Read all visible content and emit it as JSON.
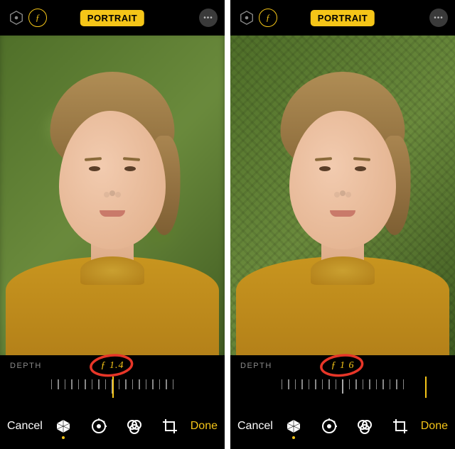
{
  "screens": [
    {
      "mode_label": "PORTRAIT",
      "depth_label": "DEPTH",
      "f_value": "ƒ 1.4",
      "background": "blurred",
      "cancel": "Cancel",
      "done": "Done",
      "needle_pos": "center",
      "annotation": "red-circle"
    },
    {
      "mode_label": "PORTRAIT",
      "depth_label": "DEPTH",
      "f_value": "ƒ 1 6",
      "background": "sharp",
      "cancel": "Cancel",
      "done": "Done",
      "needle_pos": "right",
      "annotation": "red-circle"
    }
  ],
  "icons": {
    "light_mode": "hexagon-lighting-icon",
    "aperture": "f-aperture-icon",
    "more": "more-icon",
    "cube": "portrait-lighting-icon",
    "adjust": "adjust-dial-icon",
    "filters": "filters-icon",
    "crop": "crop-rotate-icon"
  },
  "colors": {
    "accent": "#f5c518",
    "bg": "#000000",
    "annotation": "#e73628"
  }
}
